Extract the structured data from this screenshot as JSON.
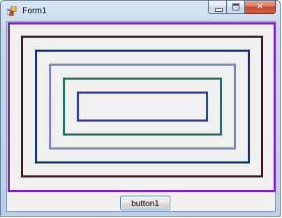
{
  "window": {
    "title": "Form1",
    "close_glyph": "✕"
  },
  "form": {
    "button_label": "button1"
  },
  "rectangles": [
    {
      "name": "rect-purple",
      "color": "#7b22c3"
    },
    {
      "name": "rect-maroon",
      "color": "#4a1820"
    },
    {
      "name": "rect-navy",
      "color": "#162f8e"
    },
    {
      "name": "rect-lavender",
      "color": "#7b82c8"
    },
    {
      "name": "rect-teal",
      "color": "#177563"
    },
    {
      "name": "rect-blue",
      "color": "#2a44a6"
    }
  ],
  "icons": [
    "app-icon",
    "minimize-icon",
    "maximize-icon",
    "close-icon"
  ]
}
